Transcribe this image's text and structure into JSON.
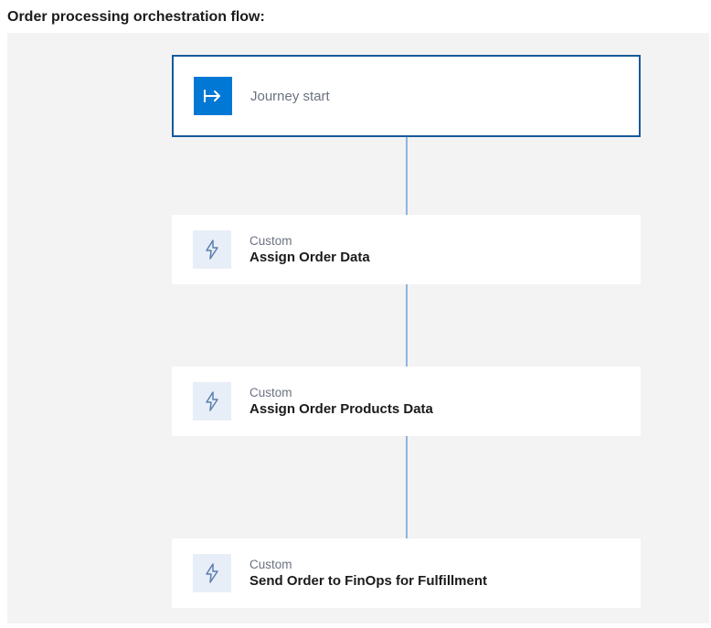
{
  "header": {
    "title": "Order processing orchestration flow:"
  },
  "flow": {
    "start": {
      "label": "Journey start"
    },
    "steps": [
      {
        "kicker": "Custom",
        "title": "Assign Order Data"
      },
      {
        "kicker": "Custom",
        "title": "Assign Order Products Data"
      },
      {
        "kicker": "Custom",
        "title": "Send Order to FinOps for Fulfillment"
      }
    ]
  }
}
